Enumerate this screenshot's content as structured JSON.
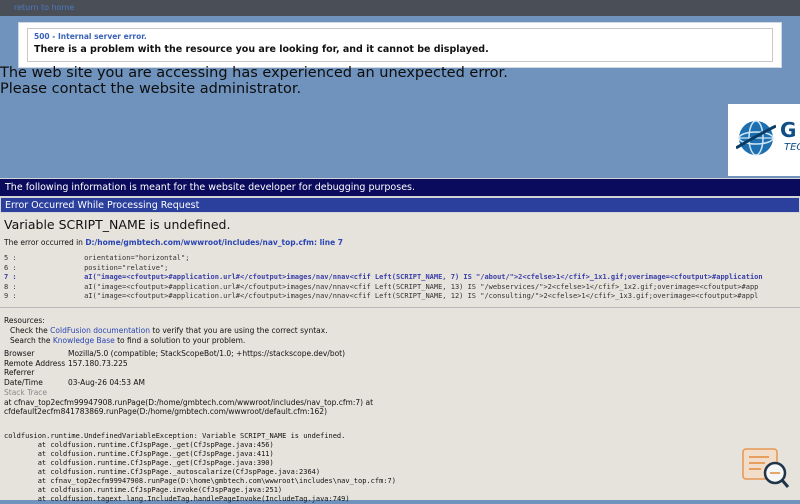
{
  "topbar": {
    "link": "return to home"
  },
  "error_box": {
    "code": "500 - Internal server error.",
    "message": "There is a problem with the resource you are looking for, and it cannot be displayed."
  },
  "site_message": {
    "line1": "The web site you are accessing has experienced an unexpected error.",
    "line2": "Please contact the website administrator."
  },
  "logo": {
    "letter": "G",
    "sub": "TECH"
  },
  "developer_bar": "The following information is meant for the website developer for debugging purposes.",
  "processing_bar": "Error Occurred While Processing Request",
  "variable_error": "Variable SCRIPT_NAME is undefined.",
  "occurred": {
    "prefix": "The error occurred in ",
    "file": "D:/home/gmbtech.com/wwwroot/includes/nav_top.cfm: line 7"
  },
  "code_lines": [
    {
      "num": "5 :",
      "text": "                orientation=\"horizontal\";"
    },
    {
      "num": "6 :",
      "text": "                position=\"relative\";"
    },
    {
      "num": "7 :",
      "text": "                aI(\"image=<cfoutput>#application.url#</cfoutput>images/nav/nnav<cfif Left(SCRIPT_NAME, 7) IS \"/about/\">2<cfelse>1</cfif>_1x1.gif;overimage=<cfoutput>#application"
    },
    {
      "num": "8 :",
      "text": "                aI(\"image=<cfoutput>#application.url#</cfoutput>images/nav/nnav<cfif Left(SCRIPT_NAME, 13) IS \"/webservices/\">2<cfelse>1</cfif>_1x2.gif;overimage=<cfoutput>#app"
    },
    {
      "num": "9 :",
      "text": "                aI(\"image=<cfoutput>#application.url#</cfoutput>images/nav/nnav<cfif Left(SCRIPT_NAME, 12) IS \"/consulting/\">2<cfelse>1</cfif>_1x3.gif;overimage=<cfoutput>#appl"
    }
  ],
  "resources": {
    "title": "Resources:",
    "line1_pre": "Check the ",
    "line1_link": "ColdFusion documentation",
    "line1_post": " to verify that you are using the correct syntax.",
    "line2_pre": "Search the ",
    "line2_link": "Knowledge Base",
    "line2_post": " to find a solution to your problem."
  },
  "info": [
    {
      "key": "Browser",
      "value": "Mozilla/5.0 (compatible; StackScopeBot/1.0; +https://stackscope.dev/bot)"
    },
    {
      "key": "Remote Address",
      "value": "157.180.73.225"
    },
    {
      "key": "Referrer",
      "value": ""
    },
    {
      "key": "Date/Time",
      "value": "03-Aug-26 04:53 AM"
    }
  ],
  "stack_trace": {
    "label": "Stack Trace",
    "line1": "at cfnav_top2ecfm99947908.runPage(D:/home/gmbtech.com/wwwroot/includes/nav_top.cfm:7) at",
    "line2": "cfdefault2ecfm841783869.runPage(D:/home/gmbtech.com/wwwroot/default.cfm:162)"
  },
  "java_trace": [
    "coldfusion.runtime.UndefinedVariableException: Variable SCRIPT_NAME is undefined.",
    "\tat coldfusion.runtime.CfJspPage._get(CfJspPage.java:456)",
    "\tat coldfusion.runtime.CfJspPage._get(CfJspPage.java:411)",
    "\tat coldfusion.runtime.CfJspPage._get(CfJspPage.java:390)",
    "\tat coldfusion.runtime.CfJspPage._autoscalarize(CfJspPage.java:2364)",
    "\tat cfnav_top2ecfm99947908.runPage(D:\\home\\gmbtech.com\\wwwroot\\includes\\nav_top.cfm:7)",
    "\tat coldfusion.runtime.CfJspPage.invoke(CfJspPage.java:251)",
    "\tat coldfusion.tagext.lang.IncludeTag.handlePageInvoke(IncludeTag.java:749)"
  ],
  "colors": {
    "background": "#6f93bd",
    "dev_bar": "#0b0b5e",
    "processing_bar": "#2b3f9d",
    "panel": "#e6e3dc",
    "link": "#2b46b3"
  }
}
